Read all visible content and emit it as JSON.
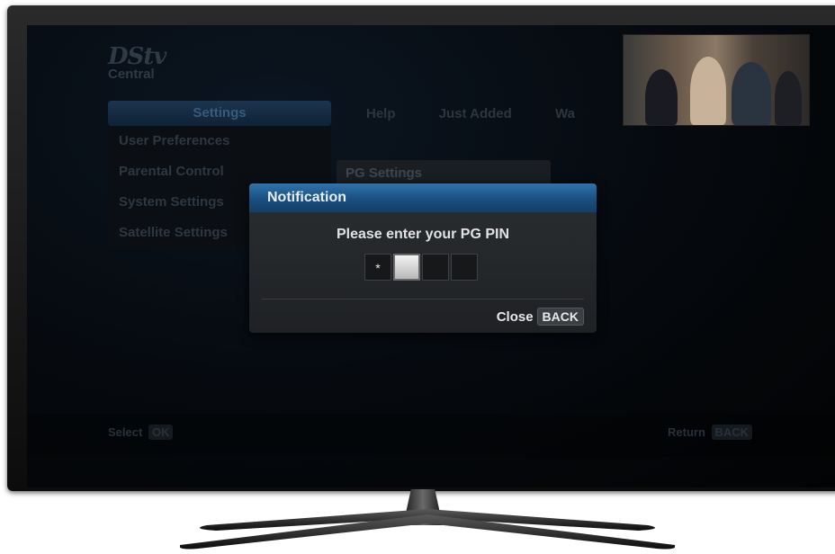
{
  "app": {
    "logo_main": "DStv",
    "logo_sub": "Central"
  },
  "menu": {
    "header": "Settings",
    "items": [
      "User Preferences",
      "Parental Control",
      "System Settings",
      "Satellite Settings"
    ]
  },
  "tabs": [
    "Help",
    "Just Added",
    "Wa"
  ],
  "submenu": {
    "selected": "PG Settings"
  },
  "dialog": {
    "title": "Notification",
    "message": "Please enter your PG PIN",
    "pin": [
      "*",
      "",
      "",
      ""
    ],
    "close_label": "Close",
    "close_key": "BACK"
  },
  "footer": {
    "left_label": "Select",
    "left_key": "OK",
    "right_label": "Return",
    "right_key": "BACK"
  },
  "colors": {
    "dialog_title": "#1a4f80",
    "screen_bg": "#05080c"
  }
}
